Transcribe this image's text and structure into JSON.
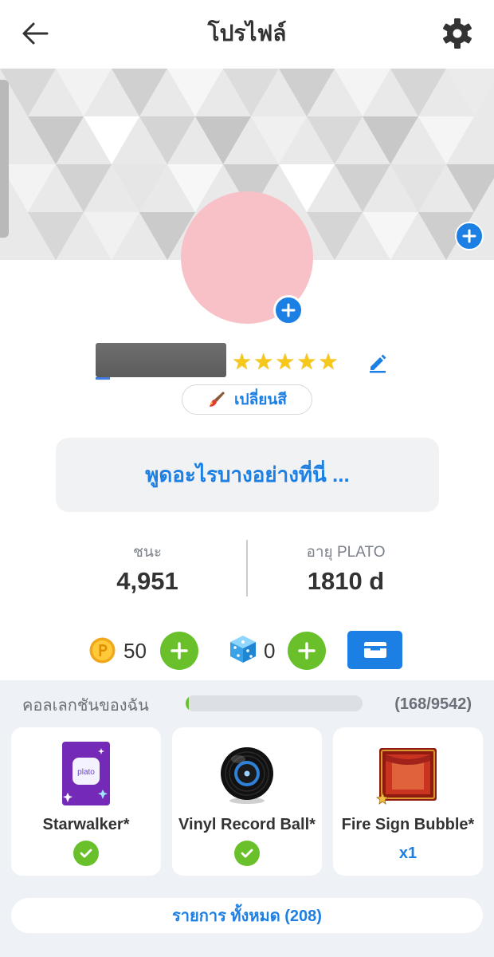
{
  "header": {
    "title": "โปรไฟล์",
    "back_icon": "arrow-left-icon",
    "settings_icon": "gear-icon"
  },
  "profile": {
    "avatar_color": "#f8c1c8",
    "username": "",
    "stars": 5,
    "change_color_label": "เปลี่ยนสี",
    "status_placeholder": "พูดอะไรบางอย่างที่นี่ ..."
  },
  "stats": {
    "wins_label": "ชนะ",
    "wins_value": "4,951",
    "age_label": "อายุ PLATO",
    "age_value": "1810 d"
  },
  "currency": {
    "coins": "50",
    "dice": "0"
  },
  "collection": {
    "title": "คอลเลกชันของฉัน",
    "count": "(168/9542)",
    "progress": 0.018,
    "items": [
      {
        "name": "Starwalker*",
        "owned": true
      },
      {
        "name": "Vinyl Record Ball*",
        "owned": true
      },
      {
        "name": "Fire Sign Bubble*",
        "quantity": "x1"
      }
    ],
    "all_items_label": "รายการ ทั้งหมด (208)"
  },
  "colors": {
    "accent": "#1b7fe3",
    "green": "#69c02b",
    "star": "#f7c81c"
  }
}
